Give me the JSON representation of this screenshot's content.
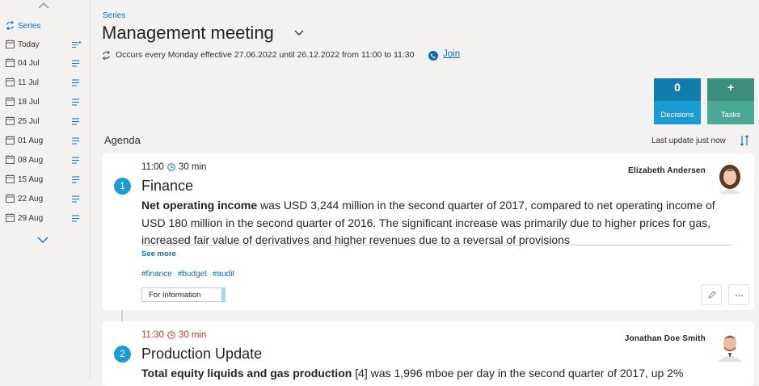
{
  "sidebar": {
    "items": [
      {
        "label": "Series",
        "icon": "repeat-icon",
        "active": true
      },
      {
        "label": "Today",
        "icon": "calendar-icon",
        "has_dot": true
      },
      {
        "label": "04 Jul",
        "icon": "calendar-icon"
      },
      {
        "label": "11 Jul",
        "icon": "calendar-icon"
      },
      {
        "label": "18 Jul",
        "icon": "calendar-icon"
      },
      {
        "label": "25 Jul",
        "icon": "calendar-icon"
      },
      {
        "label": "01 Aug",
        "icon": "calendar-icon"
      },
      {
        "label": "08 Aug",
        "icon": "calendar-icon"
      },
      {
        "label": "15 Aug",
        "icon": "calendar-icon"
      },
      {
        "label": "22 Aug",
        "icon": "calendar-icon"
      },
      {
        "label": "29 Aug",
        "icon": "calendar-icon"
      }
    ]
  },
  "header": {
    "breadcrumb": "Series",
    "title": "Management meeting",
    "recurrence": "Occurs every Monday effective 27.06.2022 until 26.12.2022 from 11:00 to 11:30",
    "join_label": "Join"
  },
  "tiles": {
    "decisions": {
      "count": "0",
      "label": "Decisions"
    },
    "tasks": {
      "count": "+",
      "label": "Tasks"
    }
  },
  "agenda": {
    "heading": "Agenda",
    "last_update": "Last update just now",
    "items": [
      {
        "number": "1",
        "time": "11:00",
        "duration": "30 min",
        "owner": "Elizabeth Andersen",
        "title": "Finance",
        "body_bold": "Net operating income",
        "body_text": " was USD 3,244 million in the second quarter of 2017, compared to net operating income of USD 180 million in the second quarter of 2016. The significant increase was primarily due to higher prices for gas, increased fair value of derivatives and higher revenues due to a reversal of provisions",
        "see_more": "See more",
        "tags": [
          "#finance",
          "#budget",
          "#audit"
        ],
        "category": "For Information"
      },
      {
        "number": "2",
        "time": "11:30",
        "duration": "30 min",
        "owner": "Jonathan Doe Smith",
        "title": "Production Update",
        "body_bold": "Total equity liquids and gas production",
        "body_text": " [4] was 1,996 mboe per day in the second quarter of 2017, up 2%"
      }
    ]
  },
  "colors": {
    "accent": "#0f6cbd",
    "badge": "#1a9bd3",
    "decisions": "#107dac",
    "tasks": "#3b8f7d",
    "late": "#d13438"
  }
}
